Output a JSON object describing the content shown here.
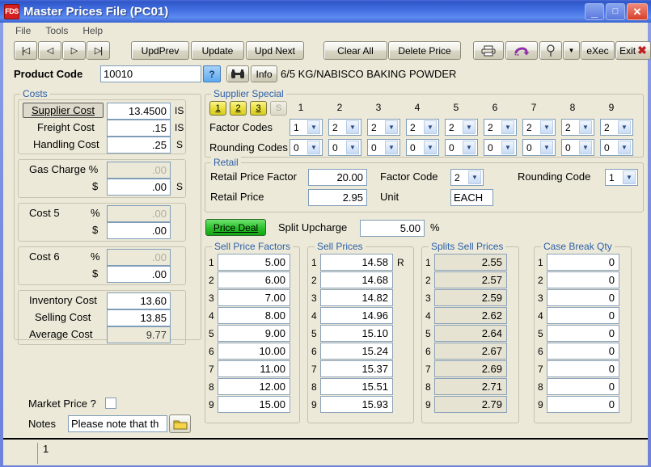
{
  "window": {
    "title": "Master Prices File  (PC01)",
    "icon_label": "FDS",
    "minimize": "_",
    "maximize": "□",
    "close": "✕"
  },
  "menu": {
    "items": [
      "File",
      "Tools",
      "Help"
    ]
  },
  "toolbar": {
    "nav": [
      {
        "name": "first",
        "glyph": "|◁"
      },
      {
        "name": "prev",
        "glyph": "◁"
      },
      {
        "name": "next",
        "glyph": "▷"
      },
      {
        "name": "last",
        "glyph": "▷|"
      }
    ],
    "upd_prev": "UpdPrev",
    "update": "Update",
    "upd_next": "Upd Next",
    "clear_all": "Clear All",
    "delete_price": "Delete Price",
    "exec": "eXec",
    "exit": "Exit"
  },
  "product": {
    "label": "Product Code",
    "code": "10010",
    "help_glyph": "?",
    "info_label": "Info",
    "description": "6/5 KG/NABISCO BAKING POWDER"
  },
  "costs": {
    "caption": "Costs",
    "rows": [
      {
        "label": "Supplier Cost",
        "value": "13.4500",
        "suffix": "IS",
        "readonly": false,
        "highlight": true
      },
      {
        "label": "Freight Cost",
        "value": ".15",
        "suffix": "IS",
        "readonly": false
      },
      {
        "label": "Handling Cost",
        "value": ".25",
        "suffix": "S",
        "readonly": false
      }
    ],
    "gas": {
      "label": "Gas Charge %",
      "pct_value": ".00",
      "dollar_label": "$",
      "dollar_value": ".00",
      "suffix": "S"
    },
    "cost5": {
      "label": "Cost 5",
      "pct_label": "%",
      "pct_value": ".00",
      "dollar_label": "$",
      "dollar_value": ".00"
    },
    "cost6": {
      "label": "Cost 6",
      "pct_label": "%",
      "pct_value": ".00",
      "dollar_label": "$",
      "dollar_value": ".00"
    },
    "totals": [
      {
        "label": "Inventory Cost",
        "value": "13.60",
        "readonly": false
      },
      {
        "label": "Selling Cost",
        "value": "13.85",
        "readonly": false
      },
      {
        "label": "Average Cost",
        "value": "9.77",
        "readonly": true
      }
    ]
  },
  "supplier_special": {
    "caption": "Supplier Special",
    "buttons": [
      {
        "label": "1",
        "active": true
      },
      {
        "label": "2",
        "active": true
      },
      {
        "label": "3",
        "active": true
      },
      {
        "label": "S",
        "active": false
      }
    ],
    "column_numbers": [
      "1",
      "2",
      "3",
      "4",
      "5",
      "6",
      "7",
      "8",
      "9"
    ],
    "factor_codes_label": "Factor Codes",
    "factor_codes": [
      "1",
      "2",
      "2",
      "2",
      "2",
      "2",
      "2",
      "2",
      "2"
    ],
    "rounding_codes_label": "Rounding Codes",
    "rounding_codes": [
      "0",
      "0",
      "0",
      "0",
      "0",
      "0",
      "0",
      "0",
      "0"
    ]
  },
  "retail": {
    "caption": "Retail",
    "price_factor_label": "Retail Price Factor",
    "price_factor": "20.00",
    "factor_code_label": "Factor Code",
    "factor_code": "2",
    "rounding_code_label": "Rounding Code",
    "rounding_code": "1",
    "retail_price_label": "Retail Price",
    "retail_price": "2.95",
    "unit_label": "Unit",
    "unit": "EACH"
  },
  "price_deal": {
    "button_label": "Price Deal",
    "split_upcharge_label": "Split Upcharge",
    "split_upcharge": "5.00",
    "percent": "%"
  },
  "columns": {
    "sell_price_factors": {
      "caption": "Sell Price Factors",
      "indices": [
        "1",
        "2",
        "3",
        "4",
        "5",
        "6",
        "7",
        "8",
        "9"
      ],
      "values": [
        "5.00",
        "6.00",
        "7.00",
        "8.00",
        "9.00",
        "10.00",
        "11.00",
        "12.00",
        "15.00"
      ],
      "readonly": false
    },
    "sell_prices": {
      "caption": "Sell Prices",
      "indices": [
        "1",
        "2",
        "3",
        "4",
        "5",
        "6",
        "7",
        "8",
        "9"
      ],
      "values": [
        "14.58",
        "14.68",
        "14.82",
        "14.96",
        "15.10",
        "15.24",
        "15.37",
        "15.51",
        "15.93"
      ],
      "suffix_first": "R",
      "readonly": false
    },
    "splits_sell_prices": {
      "caption": "Splits Sell Prices",
      "indices": [
        "1",
        "2",
        "3",
        "4",
        "5",
        "6",
        "7",
        "8",
        "9"
      ],
      "values": [
        "2.55",
        "2.57",
        "2.59",
        "2.62",
        "2.64",
        "2.67",
        "2.69",
        "2.71",
        "2.79"
      ],
      "readonly": true
    },
    "case_break_qty": {
      "caption": "Case Break Qty",
      "indices": [
        "1",
        "2",
        "3",
        "4",
        "5",
        "6",
        "7",
        "8",
        "9"
      ],
      "values": [
        "0",
        "0",
        "0",
        "0",
        "0",
        "0",
        "0",
        "0",
        "0"
      ],
      "readonly": false
    }
  },
  "footer": {
    "market_price_label": "Market Price ?",
    "market_price_checked": false,
    "notes_label": "Notes",
    "notes_value": "Please note that th"
  },
  "statusbar": {
    "text": "1"
  },
  "colors": {
    "face": "#ece9d8",
    "caption_text": "#2b5fa8",
    "title_bar": "#3f6ce0",
    "accent_yellow": "#e8df3c",
    "accent_green": "#2fc32f",
    "close_red": "#d8402a"
  }
}
